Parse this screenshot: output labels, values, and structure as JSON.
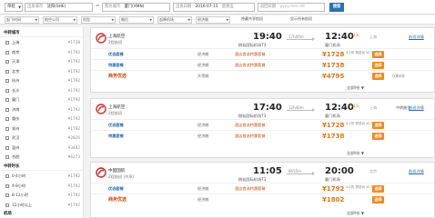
{
  "search": {
    "trip_type": "单程",
    "from_label": "出发城市",
    "from_value": "沈阳(SHE)",
    "to_label": "到达城市",
    "to_value": "厦门(XMN)",
    "date_label": "出发日期",
    "date_value": "2016-07-15",
    "weekday": "星期五",
    "return_label": "返回日期",
    "return_placeholder": "yyyy-mm-dd",
    "search_button": "搜索"
  },
  "filters": [
    {
      "label": "起飞时间"
    },
    {
      "label": "航空公司"
    },
    {
      "label": "机型"
    },
    {
      "label": "舱位"
    },
    {
      "label": "起降机场"
    },
    {
      "label": "经济舱"
    },
    {
      "label": "隐藏共享航班"
    },
    {
      "label": "显示所有航班"
    }
  ],
  "sidebar": {
    "section1_title": "中转城市",
    "cities": [
      {
        "name": "上海",
        "price": "¥1728"
      },
      {
        "name": "南京",
        "price": "¥1792"
      },
      {
        "name": "天津",
        "price": "¥1792"
      },
      {
        "name": "北京",
        "price": "¥1792"
      },
      {
        "name": "杭州",
        "price": "¥1792"
      },
      {
        "name": "长沙",
        "price": "¥1792"
      },
      {
        "name": "厦门",
        "price": "¥1792"
      },
      {
        "name": "济南",
        "price": "¥1792"
      },
      {
        "name": "重庆",
        "price": "¥1792"
      },
      {
        "name": "郑州",
        "price": "¥1792"
      },
      {
        "name": "武汉",
        "price": "¥2826"
      },
      {
        "name": "温州",
        "price": "¥3492"
      },
      {
        "name": "合肥",
        "price": "¥6273"
      }
    ],
    "section2_title": "中转时长",
    "durations": [
      {
        "name": "0-4小时",
        "price": "¥1792"
      },
      {
        "name": "4-8小时",
        "price": "¥1792"
      },
      {
        "name": "8-12小时",
        "price": "¥1792"
      },
      {
        "name": "12小时以上",
        "price": "¥1792"
      }
    ],
    "section3_title": "机场"
  },
  "flights": [
    {
      "airline": "上海航空",
      "aircraft": "2程航班",
      "dep_time": "19:40",
      "dep_airport": "桃仙国际机场T3",
      "duration": "17h00m",
      "arr_time": "12:40",
      "next_day": "+1天",
      "arr_airport": "厦门机场",
      "timing": "上海",
      "share": "",
      "detail": "航班详情",
      "logo_color": "#d32f2f",
      "fares": [
        {
          "name": "优选套餐",
          "cabin": "经济舱",
          "service": "酒店首选特惠套餐",
          "price": "¥1728",
          "disc": "4.2折 预选优 ¥1728",
          "book": "选择",
          "note": ""
        },
        {
          "name": "特惠套餐",
          "cabin": "经济舱",
          "service": "酒店首选特惠套餐",
          "price": "¥1738",
          "disc": "",
          "book": "选择",
          "note": ""
        },
        {
          "name": "商务优选",
          "cabin": "头等舱",
          "service": "",
          "price": "¥4795",
          "disc": "",
          "book": "选择",
          "note": "仅剩6张"
        }
      ],
      "more": "全部9份 ▼"
    },
    {
      "airline": "上海航空",
      "aircraft": "2程航班",
      "dep_time": "17:40",
      "dep_airport": "桃仙国际机场T3",
      "duration": "12h40m",
      "arr_time": "12:40",
      "next_day": "+1天",
      "arr_airport": "厦门机场",
      "timing": "上海",
      "share": "中转舱位",
      "detail": "航班详情",
      "logo_color": "#d32f2f",
      "fares": [
        {
          "name": "优选套餐",
          "cabin": "经济舱",
          "service": "酒店首选特惠套餐",
          "price": "¥1728",
          "disc": "4.2折 预选优 ¥1728",
          "book": "选择",
          "note": ""
        },
        {
          "name": "特惠套餐",
          "cabin": "经济舱",
          "service": "酒店首选特惠套餐",
          "price": "¥1738",
          "disc": "",
          "book": "选择",
          "note": ""
        }
      ],
      "more": "全部9份 ▼"
    },
    {
      "airline": "中国国航",
      "aircraft": "2程航班 (共享)",
      "dep_time": "11:05",
      "dep_airport": "桃仙国际机场T3",
      "duration": "8h55m",
      "arr_time": "20:00",
      "next_day": "",
      "arr_airport": "厦门机场",
      "timing": "北京",
      "share": "",
      "detail": "航班详情",
      "logo_color": "#c62828",
      "fares": [
        {
          "name": "优选套餐",
          "cabin": "经济舱",
          "service": "酒店首选特惠套餐",
          "price": "¥1792",
          "disc": "4.4折 预选优 ¥1792",
          "book": "选择",
          "note": ""
        },
        {
          "name": "商务优选",
          "cabin": "经济舱",
          "service": "",
          "price": "¥1802",
          "disc": "",
          "book": "选择",
          "note": ""
        }
      ],
      "more": "全部9份 ▼"
    }
  ]
}
